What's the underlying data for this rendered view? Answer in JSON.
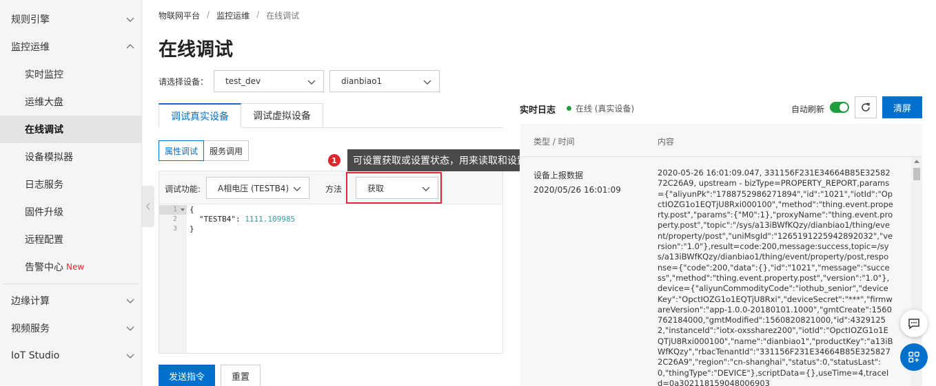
{
  "sidebar": {
    "groups": [
      {
        "label": "规则引擎",
        "expanded": false
      },
      {
        "label": "监控运维",
        "expanded": true
      },
      {
        "label": "边缘计算",
        "expanded": false
      },
      {
        "label": "视频服务",
        "expanded": false
      },
      {
        "label": "IoT Studio",
        "expanded": false
      }
    ],
    "items": [
      {
        "label": "实时监控"
      },
      {
        "label": "运维大盘"
      },
      {
        "label": "在线调试",
        "active": true
      },
      {
        "label": "设备模拟器"
      },
      {
        "label": "日志服务"
      },
      {
        "label": "固件升级"
      },
      {
        "label": "远程配置"
      },
      {
        "label": "告警中心",
        "badge": "New"
      }
    ]
  },
  "breadcrumb": [
    "物联网平台",
    "监控运维",
    "在线调试"
  ],
  "breadcrumb_sep": "/",
  "page_title": "在线调试",
  "device_select": {
    "label": "请选择设备：",
    "product": "test_dev",
    "device": "dianbiao1"
  },
  "tabs": [
    {
      "label": "调试真实设备",
      "active": true
    },
    {
      "label": "调试虚拟设备",
      "active": false
    }
  ],
  "subtabs": [
    {
      "label": "属性调试",
      "active": true
    },
    {
      "label": "服务调用",
      "active": false
    }
  ],
  "debug": {
    "function_label": "调试功能:",
    "function_value": "A相电压 (TESTB4)",
    "method_label": "方法",
    "method_value": "获取",
    "code": {
      "line_numbers": [
        "1",
        "2",
        "3"
      ],
      "open": "{",
      "key": "\"TESTB4\": ",
      "value": "1111.109985",
      "close": "}"
    }
  },
  "buttons": {
    "send": "发送指令",
    "reset": "重置",
    "clear": "清屏"
  },
  "tooltip": {
    "badge": "1",
    "text": "可设置获取或设置状态，用来读取和设置PLC的值"
  },
  "log": {
    "title": "实时日志",
    "status": "在线 (真实设备)",
    "auto_refresh_label": "自动刷新",
    "auto_refresh_on": true,
    "columns": [
      "类型 / 时间",
      "内容"
    ],
    "entry": {
      "type": "设备上报数据",
      "time": "2020/05/26 16:01:09",
      "content": "2020-05-26 16:01:09.047, 331156F231E34664B85E3258272C26A9, upstream - bizType=PROPERTY_REPORT,params={\"aliyunPk\":\"1788752986271894\",\"id\":\"1021\",\"iotId\":\"OpctIOZG1o1EQTjU8Rxi000100\",\"method\":\"thing.event.property.post\",\"params\":{\"M0\":1},\"proxyName\":\"thing.event.property.post\",\"topic\":\"/sys/a13iBWfKQzy/dianbiao1/thing/event/property/post\",\"uniMsgId\":\"1265191225942892032\",\"version\":\"1.0\"},result=code:200,message:success,topic=/sys/a13iBWfKQzy/dianbiao1/thing/event/property/post,response={\"code\":200,\"data\":{},\"id\":\"1021\",\"message\":\"success\",\"method\":\"thing.event.property.post\",\"version\":\"1.0\"},device={\"aliyunCommodityCode\":\"iothub_senior\",\"deviceKey\":\"OpctIOZG1o1EQTjU8Rxi\",\"deviceSecret\":\"***\",\"firmwareVersion\":\"app-1.0.0-20180101.1000\",\"gmtCreate\":1560762184000,\"gmtModified\":1560820821000,\"id\":43291252,\"instanceId\":\"iotx-oxssharez200\",\"iotId\":\"OpctIOZG1o1EQTjU8Rxi000100\",\"name\":\"dianbiao1\",\"productKey\":\"a13iBWfKQzy\",\"rbacTenantId\":\"331156F231E34664B85E3258272C26A9\",\"region\":\"cn-shanghai\",\"status\":0,\"statusLast\":0,\"thingType\":\"DEVICE\"},scriptData={},useTime=4,traceId=0a302118159048006903"
    }
  },
  "colors": {
    "primary": "#0070cc",
    "online": "#1e9e3c",
    "highlight": "#e1262f",
    "new_badge": "#f5222d"
  }
}
